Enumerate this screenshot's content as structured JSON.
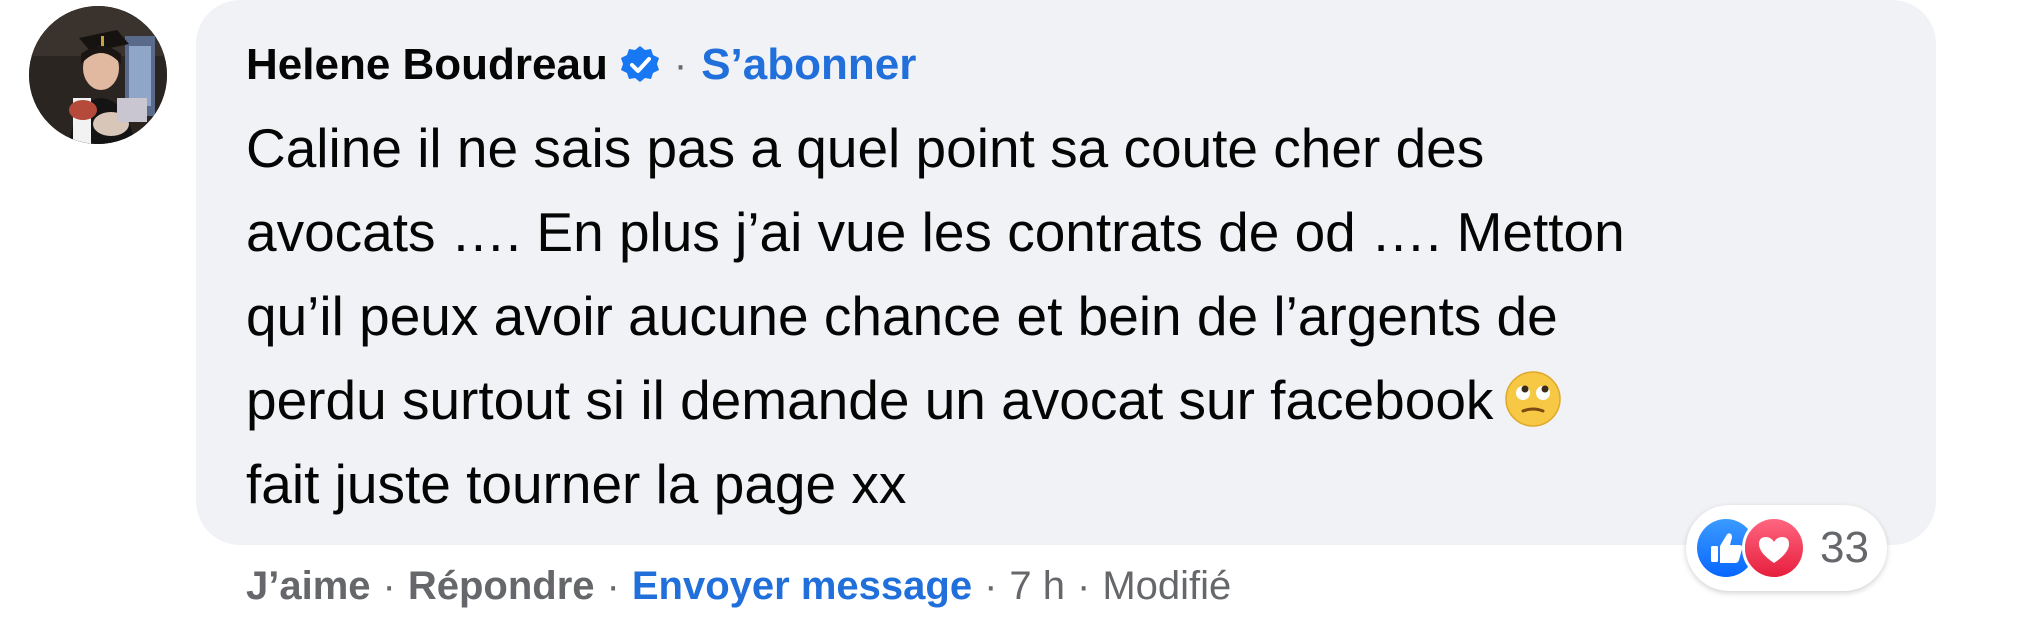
{
  "comment": {
    "author": "Helene Boudreau",
    "verified_icon": "verified-badge-icon",
    "follow_label": "S’abonner",
    "separator": "·",
    "lines": [
      "Caline il ne sais pas a quel point sa coute cher des",
      "avocats …. En plus j’ai vue les contrats de od …. Metton",
      "qu’il peux avoir aucune chance et bein de l’argents de",
      "perdu surtout si il demande un avocat sur facebook",
      "fait juste tourner la page xx"
    ],
    "emoji": "face-with-rolling-eyes-emoji",
    "reactions": {
      "icons": [
        "like-icon",
        "love-icon"
      ],
      "count": "33"
    },
    "actions": {
      "like": "J’aime",
      "reply": "Répondre",
      "message": "Envoyer message",
      "time": "7 h",
      "edited": "Modifié"
    }
  },
  "colors": {
    "bubble": "#f0f2f5",
    "link_blue": "#216fdb",
    "muted": "#65676b",
    "text": "#050505"
  }
}
